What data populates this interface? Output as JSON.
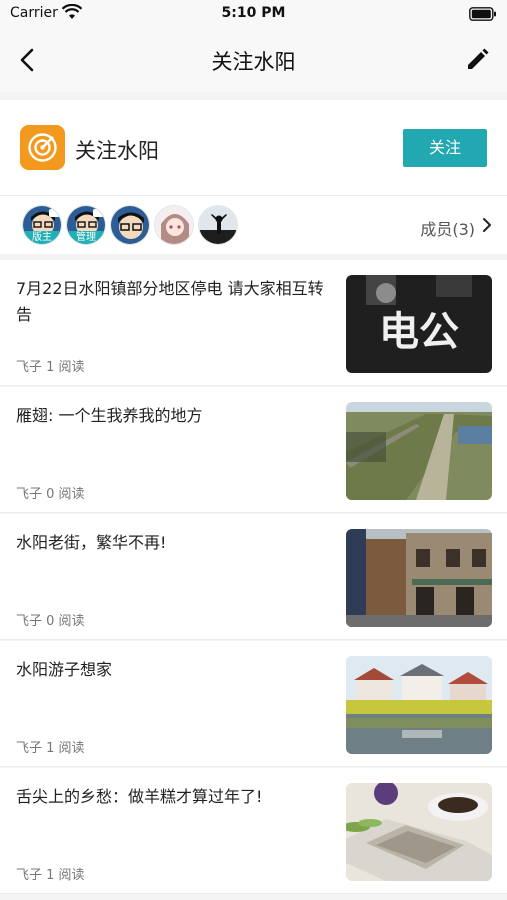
{
  "status_bar": {
    "carrier": "Carrier",
    "time": "5:10 PM"
  },
  "nav": {
    "title": "关注水阳",
    "back_icon": "chevron-left-icon",
    "edit_icon": "pencil-icon"
  },
  "group": {
    "name": "关注水阳",
    "follow_label": "关注",
    "logo_color": "#f08a1c",
    "accent_color": "#22a8b0"
  },
  "members": {
    "label": "成员(3)",
    "badges": [
      "版主",
      "管理",
      "",
      "",
      ""
    ]
  },
  "articles": [
    {
      "title": "7月22日水阳镇部分地区停电 请大家相互转告",
      "author": "飞子",
      "reads": "1 阅读",
      "thumb_text": "电公"
    },
    {
      "title": "雁翅: 一个生我养我的地方",
      "author": "飞子",
      "reads": "0 阅读"
    },
    {
      "title": "水阳老街，繁华不再!",
      "author": "飞子",
      "reads": "0 阅读"
    },
    {
      "title": "水阳游子想家",
      "author": "飞子",
      "reads": "1 阅读"
    },
    {
      "title": "舌尖上的乡愁：做羊糕才算过年了!",
      "author": "飞子",
      "reads": "1 阅读"
    }
  ]
}
